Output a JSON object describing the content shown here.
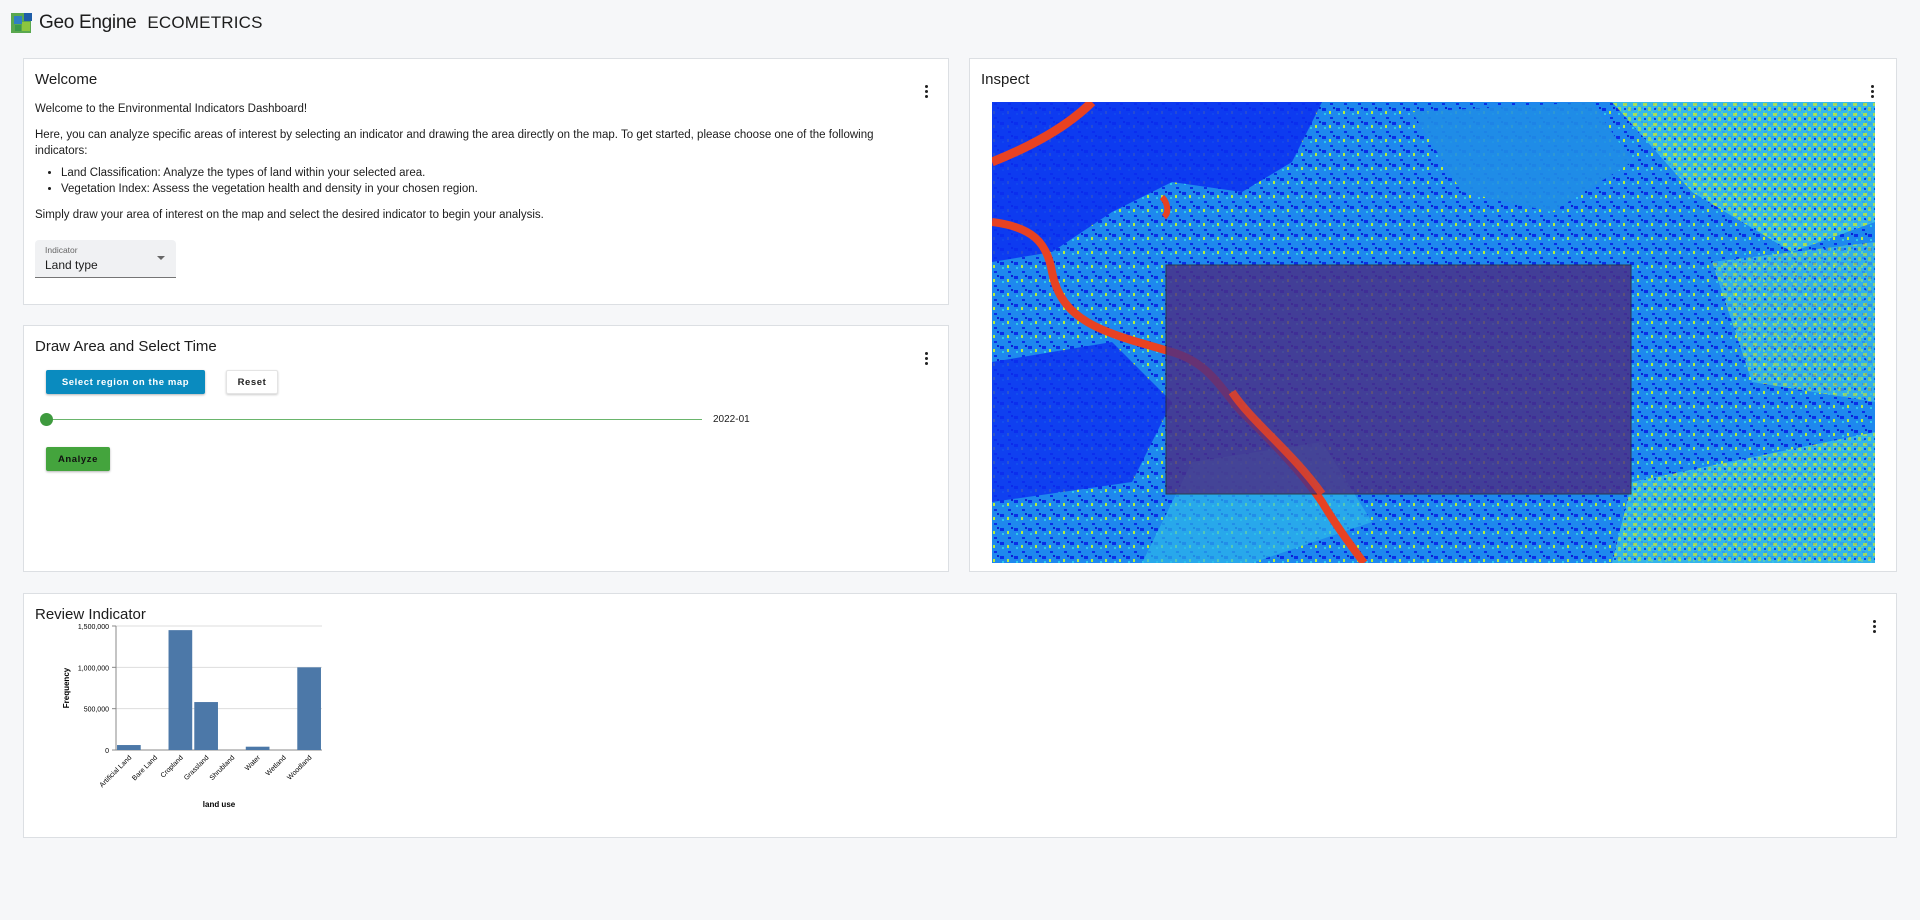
{
  "header": {
    "brand": "Geo Engine",
    "app_name": "ECOMETRICS"
  },
  "welcome": {
    "title": "Welcome",
    "intro": "Welcome to the Environmental Indicators Dashboard!",
    "description": "Here, you can analyze specific areas of interest by selecting an indicator and drawing the area directly on the map. To get started, please choose one of the following indicators:",
    "indicators": [
      "Land Classification: Analyze the types of land within your selected area.",
      "Vegetation Index: Assess the vegetation health and density in your chosen region."
    ],
    "instruction": "Simply draw your area of interest on the map and select the desired indicator to begin your analysis.",
    "indicator_select": {
      "label": "Indicator",
      "value": "Land type"
    }
  },
  "draw": {
    "title": "Draw Area and Select Time",
    "select_region_label": "Select region on the map",
    "reset_label": "Reset",
    "time_value": "2022-01",
    "time_position": 0,
    "analyze_label": "Analyze"
  },
  "inspect": {
    "title": "Inspect"
  },
  "review": {
    "title": "Review Indicator"
  },
  "chart_data": {
    "type": "bar",
    "categories": [
      "Artificial Land",
      "Bare Land",
      "Cropland",
      "Grassland",
      "Shrubland",
      "Water",
      "Wetland",
      "Woodland"
    ],
    "values": [
      60000,
      0,
      1450000,
      580000,
      0,
      40000,
      0,
      1000000
    ],
    "xlabel": "land use",
    "ylabel": "Frequency",
    "ylim": [
      0,
      1500000
    ],
    "yticks": [
      0,
      500000,
      1000000,
      1500000
    ],
    "ytick_labels": [
      "0",
      "500,000",
      "1,000,000",
      "1,500,000"
    ],
    "bar_color": "#4c78a8",
    "grid": true
  }
}
